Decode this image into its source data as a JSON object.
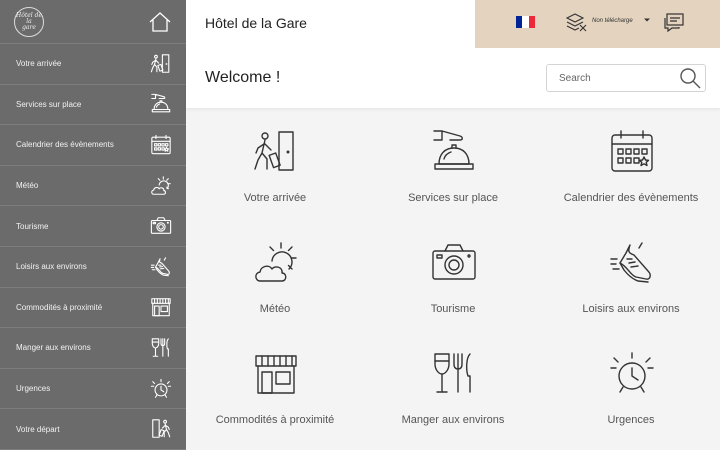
{
  "sidebar": {
    "logo_text": [
      "Hôtel de la",
      "gare"
    ],
    "items": [
      {
        "label": "Votre arrivée",
        "icon": "arrival-icon"
      },
      {
        "label": "Services sur place",
        "icon": "service-bell-icon"
      },
      {
        "label": "Calendrier des évènements",
        "icon": "calendar-icon"
      },
      {
        "label": "Météo",
        "icon": "weather-icon"
      },
      {
        "label": "Tourisme",
        "icon": "camera-icon"
      },
      {
        "label": "Loisirs aux environs",
        "icon": "sneaker-icon"
      },
      {
        "label": "Commodités à proximité",
        "icon": "shop-icon"
      },
      {
        "label": "Manger aux environs",
        "icon": "dining-icon"
      },
      {
        "label": "Urgences",
        "icon": "alarm-clock-icon"
      },
      {
        "label": "Votre départ",
        "icon": "departure-icon"
      }
    ]
  },
  "header": {
    "title": "Hôtel de la Gare",
    "download_label": "Non télécharge",
    "flag_colors": [
      "#002395",
      "#ffffff",
      "#ed2939"
    ]
  },
  "welcome": {
    "title": "Welcome !",
    "search_placeholder": "Search"
  },
  "tiles": [
    {
      "label": "Votre arrivée",
      "icon": "arrival-icon"
    },
    {
      "label": "Services sur place",
      "icon": "service-bell-icon"
    },
    {
      "label": "Calendrier des évènements",
      "icon": "calendar-icon"
    },
    {
      "label": "Météo",
      "icon": "weather-icon"
    },
    {
      "label": "Tourisme",
      "icon": "camera-icon"
    },
    {
      "label": "Loisirs aux environs",
      "icon": "sneaker-icon"
    },
    {
      "label": "Commodités à proximité",
      "icon": "shop-icon"
    },
    {
      "label": "Manger aux environs",
      "icon": "dining-icon"
    },
    {
      "label": "Urgences",
      "icon": "alarm-clock-icon"
    }
  ],
  "colors": {
    "sidebar_bg": "#6b6b6b",
    "tools_bg": "#e3d3bf",
    "icon_stroke": "#333333"
  }
}
